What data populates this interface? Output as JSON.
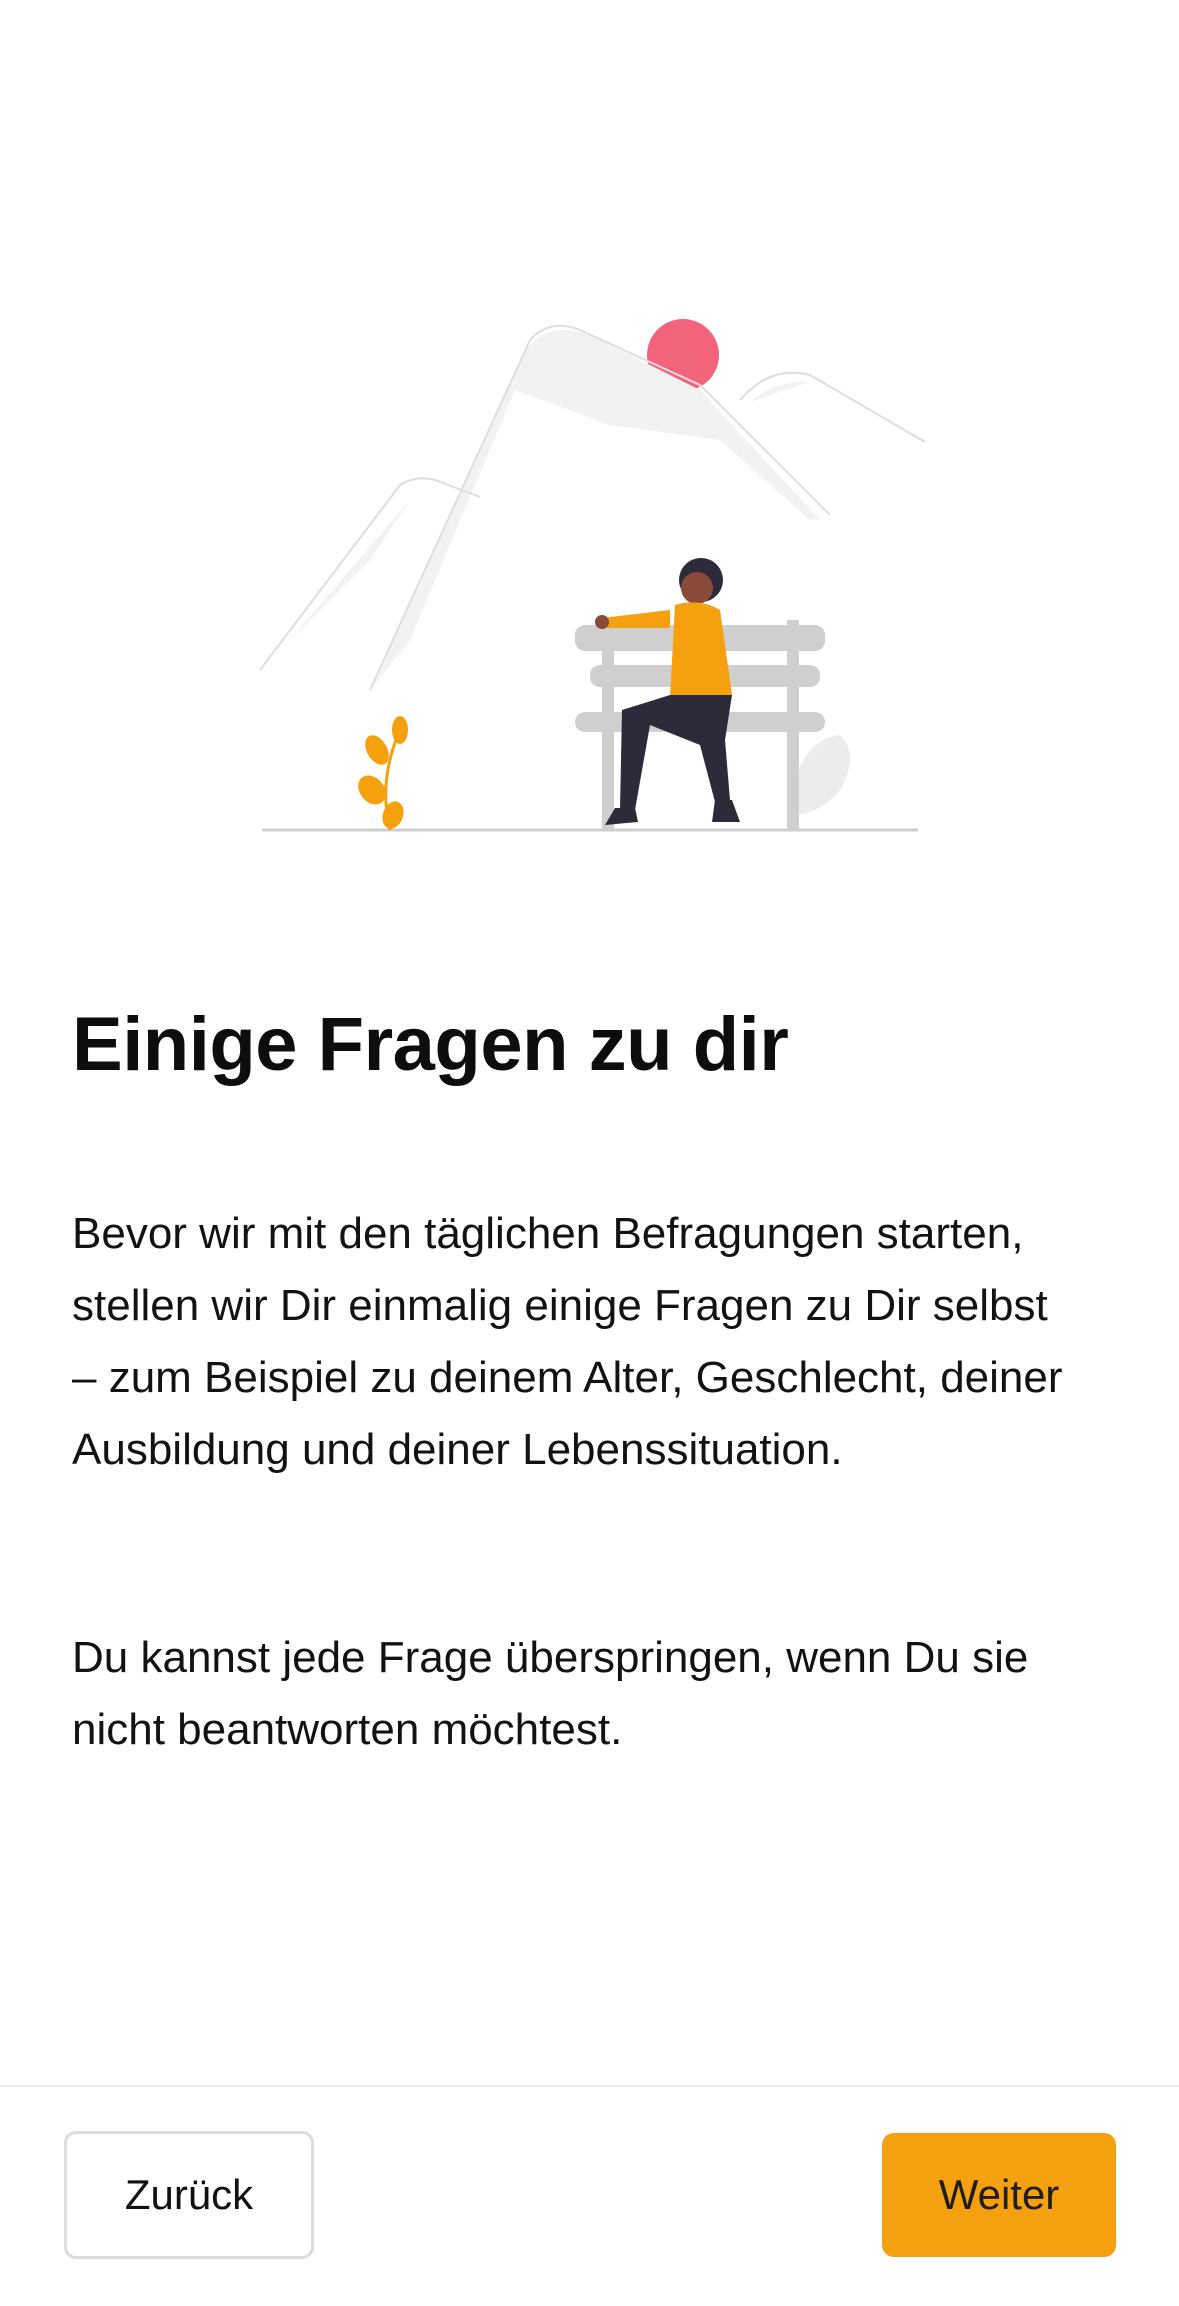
{
  "content": {
    "title": "Einige Fragen zu dir",
    "paragraph_1": "Bevor wir mit den täglichen Befragungen starten, stellen wir Dir einmalig einige Fragen zu Dir selbst – zum Beispiel zu deinem Alter, Geschlecht, deiner Ausbildung und deiner Lebenssituation.",
    "paragraph_2": "Du kannst jede Frage überspringen, wenn Du sie nicht beantworten möchtest."
  },
  "footer": {
    "back_label": "Zurück",
    "next_label": "Weiter"
  },
  "colors": {
    "accent": "#f4a00f",
    "sun": "#f2647c",
    "bench": "#cfcfcf"
  }
}
